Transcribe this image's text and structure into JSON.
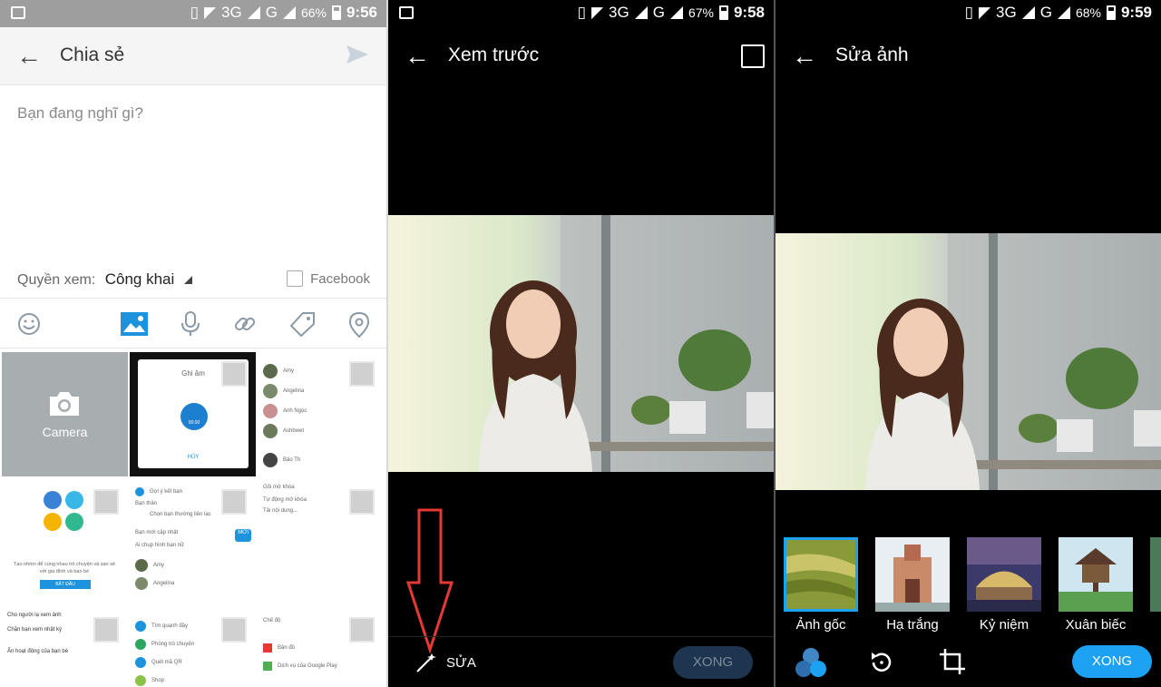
{
  "status": [
    {
      "network": "3G",
      "network2": "G",
      "battery": "66%",
      "time": "9:56"
    },
    {
      "network": "3G",
      "network2": "G",
      "battery": "67%",
      "time": "9:58"
    },
    {
      "network": "3G",
      "network2": "G",
      "battery": "68%",
      "time": "9:59"
    }
  ],
  "share": {
    "title": "Chia sẻ",
    "compose_placeholder": "Bạn đang nghĩ gì?",
    "privacy_label": "Quyền xem:",
    "privacy_value": "Công khai",
    "facebook_label": "Facebook",
    "camera_label": "Camera",
    "thumbs": {
      "record_title": "Ghi âm",
      "record_time": "00:00",
      "record_cancel": "HỦY",
      "contacts": [
        "Amy",
        "Angelina",
        "Anh Ngọc",
        "Ashbwet",
        "Bảo Th"
      ],
      "groups_text": "Tạo nhóm để cùng nhau trò chuyện và san sẻ với gia đình và bạn bè",
      "groups_button": "BẮT ĐẦU",
      "suggest": [
        "Gợi ý kết bạn",
        "Bạn thân",
        "Chọn bạn thường liên lạc",
        "Bạn mới cập nhật",
        "Ai chụp hình bạn nữ"
      ],
      "suggest_badge": "MỚI",
      "contacts2": [
        "Amy",
        "Angelina"
      ],
      "settings": [
        "Gõi mở khóa",
        "Tự động mở khóa",
        "Tải nội dung..."
      ],
      "bottom_left": [
        "Cho người lạ xem ảnh",
        "Chặn bạn xem nhật ký",
        "Ẩn hoạt động của bạn bè"
      ],
      "nearby": [
        "Tìm quanh đây",
        "Phòng trò chuyện",
        "Quét mã QR",
        "Shop"
      ],
      "nearby2": [
        "Chế độ",
        "Bản đồ",
        "Dịch vụ của Google Play"
      ]
    },
    "send_icon": "send-icon",
    "toolbar_icons": [
      "emoji-icon",
      "image-icon",
      "mic-icon",
      "link-icon",
      "tag-icon",
      "location-icon"
    ]
  },
  "preview": {
    "title": "Xem trước",
    "edit_label": "SỬA",
    "done_label": "XONG"
  },
  "editor": {
    "title": "Sửa ảnh",
    "filters": [
      {
        "label": "Ảnh gốc",
        "active": true
      },
      {
        "label": "Hạ trắng",
        "active": false
      },
      {
        "label": "Kỷ niệm",
        "active": false
      },
      {
        "label": "Xuân biếc",
        "active": false
      }
    ],
    "done_label": "XONG",
    "tool_icons": [
      "color-circles-icon",
      "rotate-icon",
      "crop-icon"
    ]
  },
  "colors": {
    "accent": "#1da1f2",
    "accent_disabled": "#1e3550",
    "annotation_arrow": "#e53935"
  }
}
